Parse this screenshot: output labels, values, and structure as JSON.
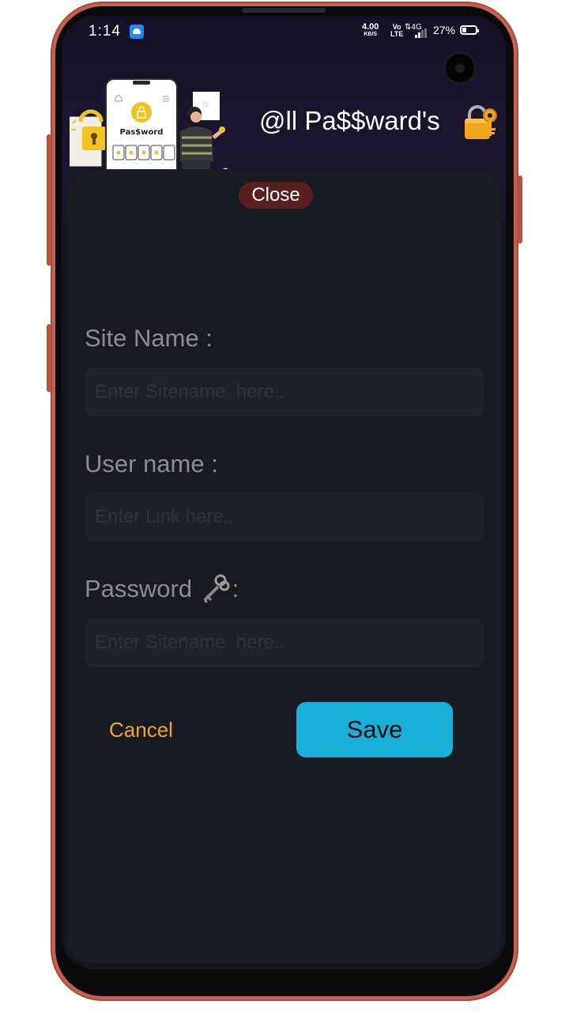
{
  "status_bar": {
    "time": "1:14",
    "net_speed": "4.00",
    "net_speed_unit": "KB/S",
    "volte_top": "Vo",
    "volte_bottom": "LTE",
    "network": "4G",
    "battery_percent": "27%",
    "battery_level": 0.27
  },
  "header": {
    "title": "@ll Pa$$ward's",
    "illustration_text": "Pas$word",
    "lock_icon": "lock-key-emoji"
  },
  "dialog": {
    "close_label": "Close",
    "site_name_label": "Site Name :",
    "site_name_placeholder": "Enter Sitename  here..",
    "user_name_label": "User name  :",
    "user_name_placeholder": "Enter Link here..",
    "password_label": "Password",
    "password_label_suffix": " :",
    "password_placeholder": "Enter Sitename  here..",
    "cancel_label": "Cancel",
    "save_label": "Save"
  },
  "colors": {
    "accent_save": "#1aafd9",
    "cancel_text": "#f2a51e",
    "close_bg": "#5a1f1f",
    "sheet_bg": "#181b21"
  }
}
